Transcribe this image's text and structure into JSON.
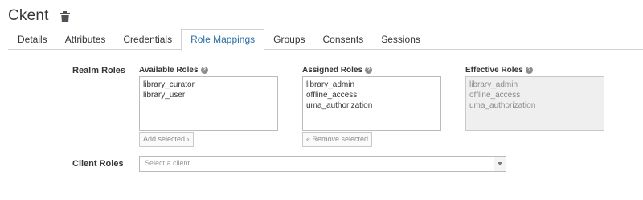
{
  "header": {
    "title": "Ckent",
    "delete_icon": "trash-icon"
  },
  "tabs": [
    {
      "label": "Details",
      "active": false
    },
    {
      "label": "Attributes",
      "active": false
    },
    {
      "label": "Credentials",
      "active": false
    },
    {
      "label": "Role Mappings",
      "active": true
    },
    {
      "label": "Groups",
      "active": false
    },
    {
      "label": "Consents",
      "active": false
    },
    {
      "label": "Sessions",
      "active": false
    }
  ],
  "realm_roles": {
    "label": "Realm Roles",
    "available": {
      "label": "Available Roles",
      "items": [
        "library_curator",
        "library_user"
      ]
    },
    "assigned": {
      "label": "Assigned Roles",
      "items": [
        "library_admin",
        "offline_access",
        "uma_authorization"
      ]
    },
    "effective": {
      "label": "Effective Roles",
      "items": [
        "library_admin",
        "offline_access",
        "uma_authorization"
      ]
    },
    "add_button": "Add selected ›",
    "remove_button": "« Remove selected"
  },
  "client_roles": {
    "label": "Client Roles",
    "select_placeholder": "Select a client..."
  },
  "colors": {
    "accent": "#2b6ea8",
    "text": "#363636",
    "border": "#d1d1d1"
  }
}
